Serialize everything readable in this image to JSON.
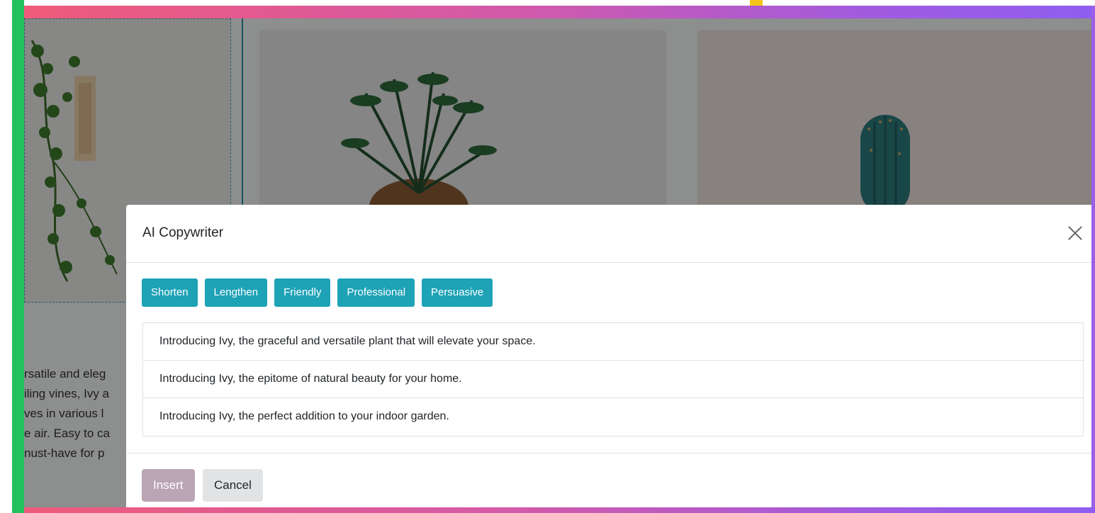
{
  "background": {
    "description_lines": [
      "rsatile and eleg",
      "iling vines, Ivy a",
      "ves in various l",
      "e air. Easy to ca",
      "nust-have for p"
    ]
  },
  "modal": {
    "title": "AI Copywriter",
    "tone_buttons": [
      {
        "label": "Shorten"
      },
      {
        "label": "Lengthen"
      },
      {
        "label": "Friendly"
      },
      {
        "label": "Professional"
      },
      {
        "label": "Persuasive"
      }
    ],
    "suggestions": [
      {
        "text": "Introducing Ivy, the graceful and versatile plant that will elevate your space."
      },
      {
        "text": "Introducing Ivy, the epitome of natural beauty for your home."
      },
      {
        "text": "Introducing Ivy, the perfect addition to your indoor garden."
      }
    ],
    "footer": {
      "insert_label": "Insert",
      "cancel_label": "Cancel"
    }
  },
  "colors": {
    "accent": "#1ea2b6",
    "insert_disabled": "#b9a5b4",
    "frame_green": "#22c05e"
  }
}
